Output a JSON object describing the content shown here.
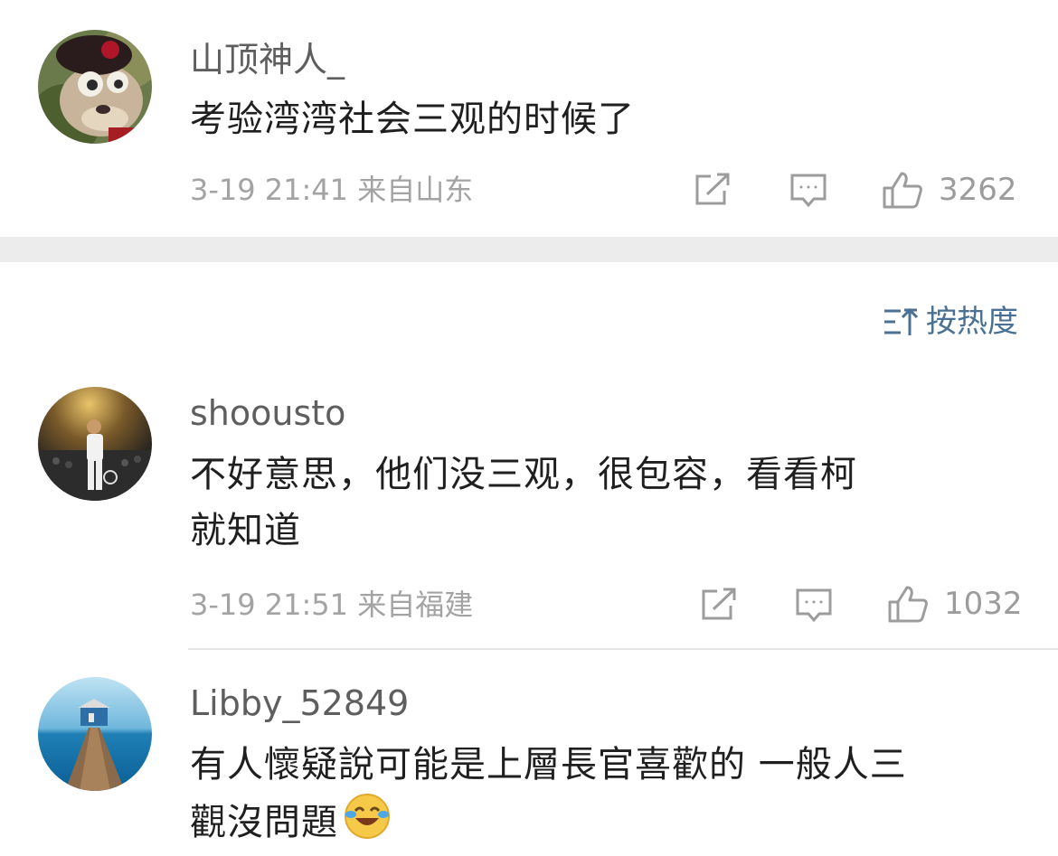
{
  "comments": [
    {
      "username": "山顶神人_",
      "text": "考验湾湾社会三观的时候了",
      "meta": "3-19 21:41 来自山东",
      "likes": "3262"
    },
    {
      "username": "shoousto",
      "text_line1": "不好意思，他们没三观，很包容，看看柯",
      "text_line2": "就知道",
      "meta": "3-19 21:51 来自福建",
      "likes": "1032"
    },
    {
      "username": "Libby_52849",
      "text_line1": "有人懷疑說可能是上層長官喜歡的 一般人三",
      "text_line2": "觀沒問題"
    }
  ],
  "sort": {
    "label": "按热度",
    "icon": "sort-icon"
  },
  "icons": {
    "share": "share-icon",
    "comment": "comment-icon",
    "like": "thumbs-up-icon",
    "emoji": "laughing-crying-emoji"
  },
  "colors": {
    "sort_accent": "#4a7094",
    "meta_gray": "#a3a3a3",
    "divider_band": "#ececec"
  }
}
